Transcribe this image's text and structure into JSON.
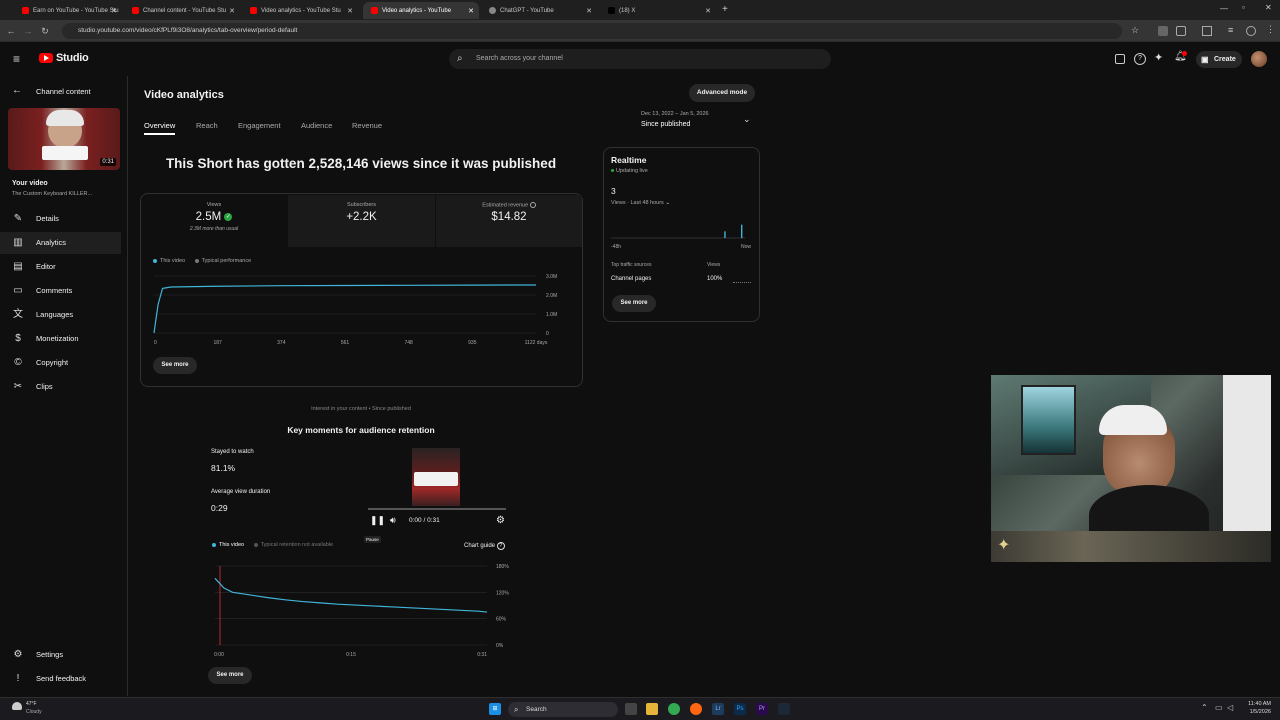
{
  "browser": {
    "tabs": [
      {
        "label": "Earn on YouTube - YouTube Stu",
        "active": false
      },
      {
        "label": "Channel content - YouTube Stu",
        "active": false
      },
      {
        "label": "Video analytics - YouTube Stu",
        "active": false
      },
      {
        "label": "Video analytics - YouTube",
        "active": true
      },
      {
        "label": "ChatGPT - YouTube",
        "active": false
      },
      {
        "label": "(18) X",
        "active": false
      }
    ],
    "url": "studio.youtube.com/video/cKfPLf9i3O8/analytics/tab-overview/period-default"
  },
  "header": {
    "logo": "Studio",
    "search_placeholder": "Search across your channel",
    "create_label": "Create"
  },
  "sidebar": {
    "back_label": "Channel content",
    "thumb_duration": "0:31",
    "your_video_label": "Your video",
    "video_title": "The Custom Keyboard KILLER...",
    "items": [
      {
        "label": "Details",
        "icon": "pencil-icon"
      },
      {
        "label": "Analytics",
        "icon": "analytics-icon"
      },
      {
        "label": "Editor",
        "icon": "editor-icon"
      },
      {
        "label": "Comments",
        "icon": "comments-icon"
      },
      {
        "label": "Languages",
        "icon": "languages-icon"
      },
      {
        "label": "Monetization",
        "icon": "dollar-icon"
      },
      {
        "label": "Copyright",
        "icon": "copyright-icon"
      },
      {
        "label": "Clips",
        "icon": "scissors-icon"
      }
    ],
    "settings_label": "Settings",
    "feedback_label": "Send feedback"
  },
  "main": {
    "title": "Video analytics",
    "advanced_mode": "Advanced mode",
    "tabs": [
      "Overview",
      "Reach",
      "Engagement",
      "Audience",
      "Revenue"
    ],
    "date_range": "Dec 13, 2022 – Jan 5, 2026",
    "date_label": "Since published",
    "headline": "This Short has gotten 2,528,146 views since it was published",
    "metrics": [
      {
        "label": "Views",
        "value": "2.5M",
        "sub": "2.3M more than usual"
      },
      {
        "label": "Subscribers",
        "value": "+2.2K",
        "sub": ""
      },
      {
        "label": "Estimated revenue",
        "value": "$14.82",
        "sub": ""
      }
    ],
    "legend_this": "This video",
    "legend_typical": "Typical performance",
    "see_more": "See more",
    "interest_caption": "Interest in your content • Since published",
    "key_moments_title": "Key moments for audience retention",
    "stayed_label": "Stayed to watch",
    "stayed_value": "81.1%",
    "avg_label": "Average view duration",
    "avg_value": "0:29",
    "retention_legend_this": "This video",
    "retention_legend_typical": "Typical retention not available",
    "chart_guide": "Chart guide",
    "player_time": "0:00 / 0:31",
    "pause_tooltip": "Pause"
  },
  "realtime": {
    "title": "Realtime",
    "status": "Updating live",
    "value": "3",
    "views_label": "Views · Last 48 hours",
    "axis_start": "-48h",
    "axis_end": "Now",
    "sources_header": "Top traffic sources",
    "views_header": "Views",
    "source_name": "Channel pages",
    "source_pct": "100%",
    "see_more": "See more"
  },
  "taskbar": {
    "weather_temp": "47°F",
    "weather_cond": "Cloudy",
    "search_label": "Search",
    "time": "11:40 AM",
    "date": "1/5/2026"
  },
  "colors": {
    "accent_blue": "#41b4d9",
    "brand_red": "#ff0000",
    "green_badge": "#2ba640"
  },
  "chart_data": [
    {
      "type": "line",
      "x": [
        0,
        12,
        25,
        50,
        187,
        374,
        561,
        748,
        935,
        1122
      ],
      "y": [
        0,
        1500000,
        2350000,
        2420000,
        2460000,
        2490000,
        2500000,
        2510000,
        2520000,
        2528146
      ],
      "x_ticks": [
        "0",
        "187",
        "374",
        "561",
        "748",
        "935",
        "1122 days"
      ],
      "y_ticks": [
        "0",
        "1.0M",
        "2.0M",
        "3.0M"
      ],
      "ylim": [
        0,
        3000000
      ],
      "xlim": [
        0,
        1122
      ],
      "series": [
        {
          "name": "This video"
        }
      ]
    },
    {
      "type": "line",
      "x": [
        0,
        1,
        2,
        4,
        6,
        8,
        10,
        12,
        14,
        16,
        18,
        20,
        22,
        24,
        26,
        28,
        30,
        31
      ],
      "y": [
        152,
        130,
        120,
        114,
        108,
        103,
        99,
        96,
        93,
        91,
        89,
        87,
        85,
        83,
        81,
        79,
        77,
        75
      ],
      "x_ticks": [
        "0:00",
        "0:15",
        "0:31"
      ],
      "y_ticks": [
        "0%",
        "60%",
        "120%",
        "180%"
      ],
      "ylim": [
        0,
        180
      ],
      "xlim": [
        0,
        31
      ],
      "series": [
        {
          "name": "This video"
        }
      ]
    },
    {
      "type": "bar",
      "x": [
        -48,
        -6,
        0
      ],
      "y": [
        0,
        1,
        2
      ],
      "x_ticks": [
        "-48h",
        "Now"
      ],
      "series": [
        {
          "name": "Views"
        }
      ]
    }
  ]
}
